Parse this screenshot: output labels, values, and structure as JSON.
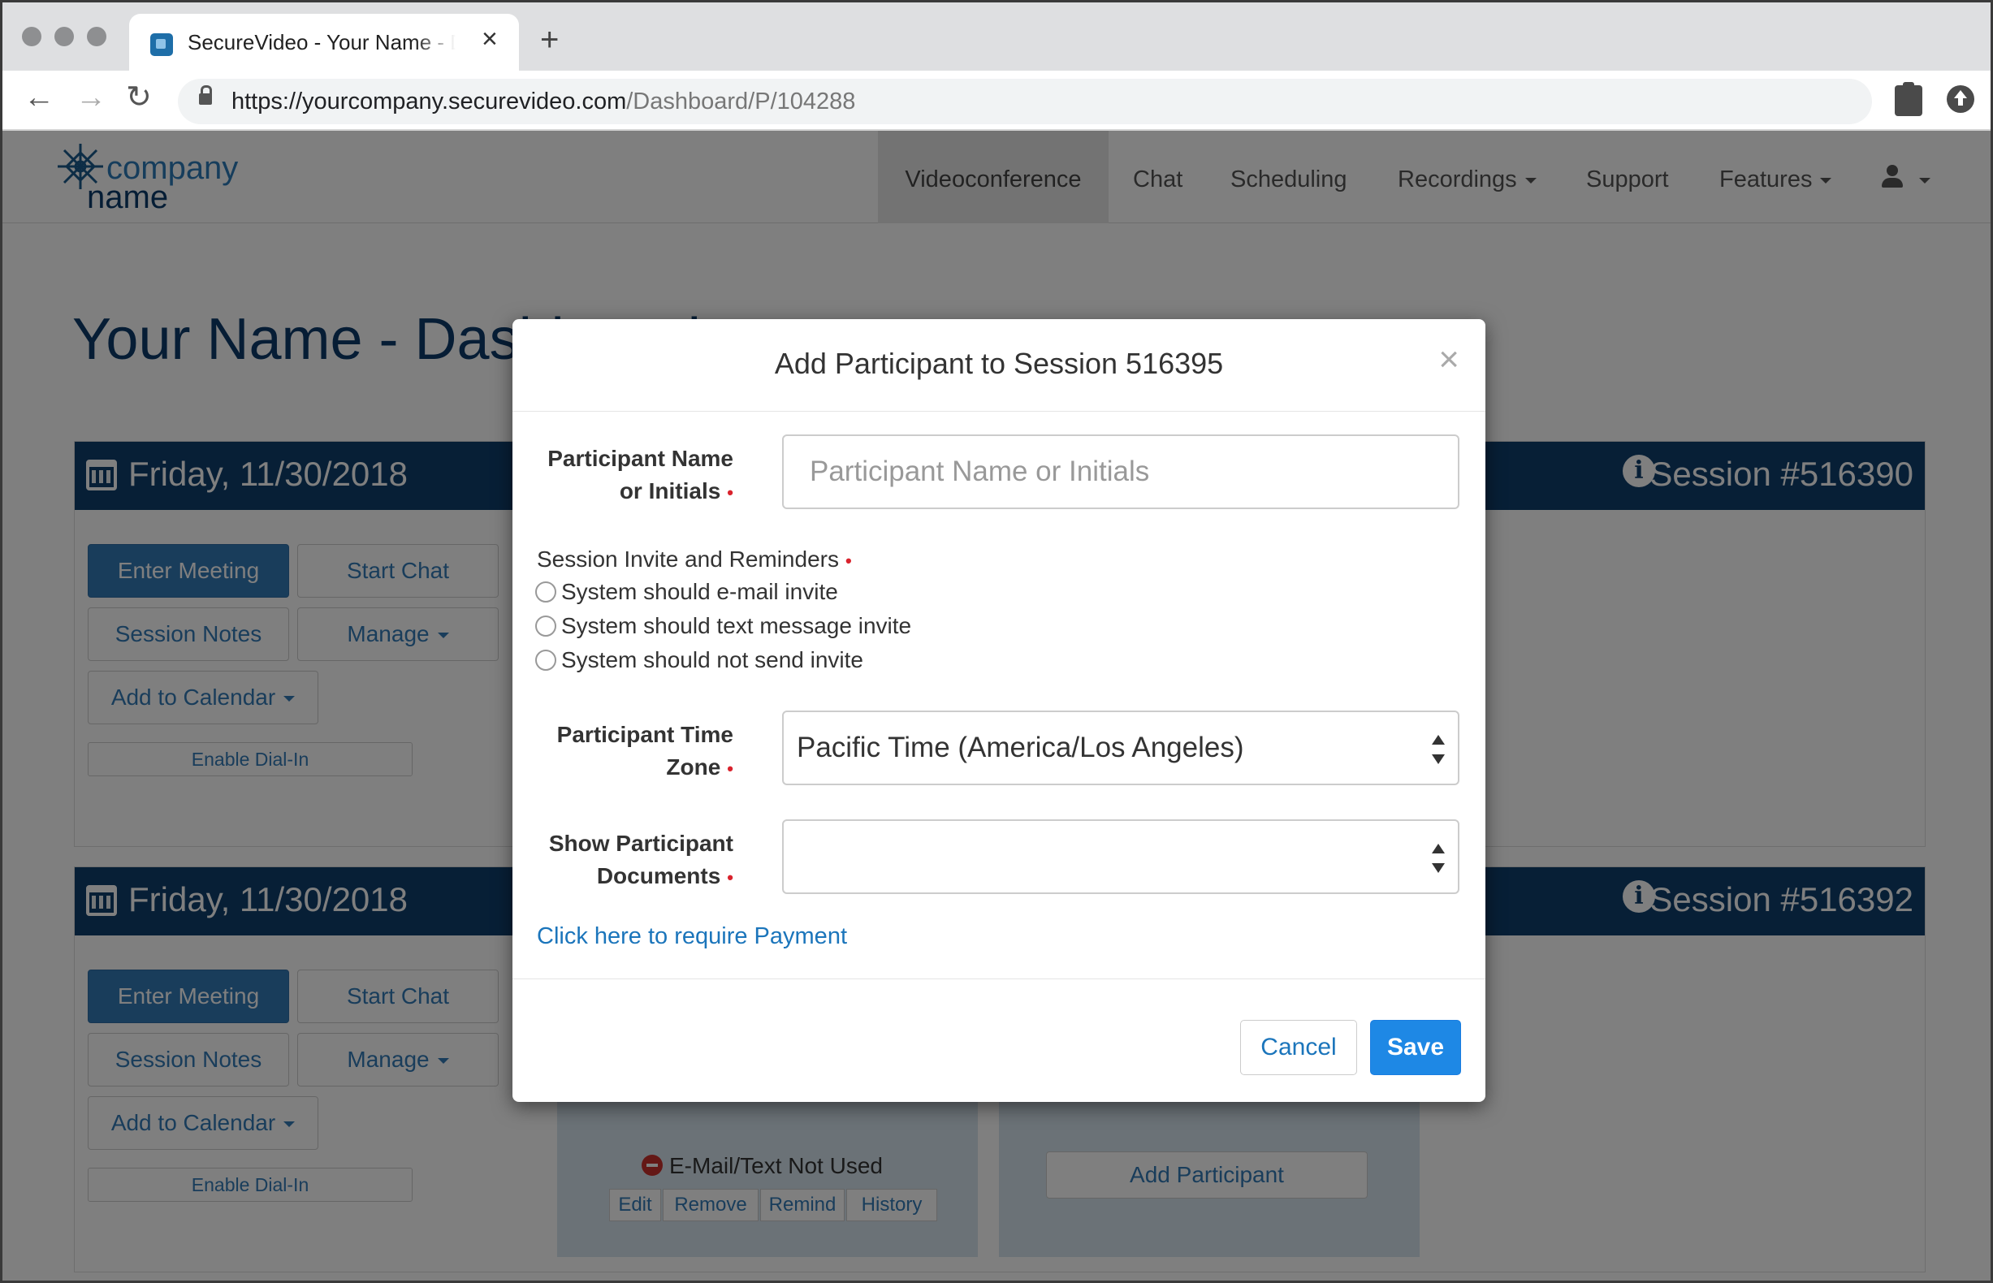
{
  "browser": {
    "tab_title": "SecureVideo - Your Name - Dashboard",
    "url_host": "https://yourcompany.securevideo.com",
    "url_path": "/Dashboard/P/104288"
  },
  "brand": {
    "line1": "company",
    "line2": "name"
  },
  "nav": {
    "items": [
      "Videoconference",
      "Chat",
      "Scheduling",
      "Recordings",
      "Support",
      "Features"
    ]
  },
  "page": {
    "title": "Your Name - Dashboard"
  },
  "sessions": [
    {
      "date": "Friday, 11/30/2018",
      "session": "Session #516390"
    },
    {
      "date": "Friday, 11/30/2018",
      "session": "Session #516392"
    }
  ],
  "card_buttons": {
    "enter_meeting": "Enter Meeting",
    "start_chat": "Start Chat",
    "session_notes": "Session Notes",
    "manage": "Manage",
    "add_to_calendar": "Add to Calendar",
    "enable_dial_in": "Enable Dial-In"
  },
  "participant_panel": {
    "status": "E-Mail/Text Not Used",
    "actions": [
      "Edit",
      "Remove",
      "Remind",
      "History"
    ],
    "add_participant": "Add Participant"
  },
  "modal": {
    "title": "Add Participant to Session 516395",
    "name_label_1": "Participant Name",
    "name_label_2": "or Initials",
    "name_placeholder": "Participant Name or Initials",
    "invite_label": "Session Invite and Reminders",
    "invite_options": [
      "System should e-mail invite",
      "System should text message invite",
      "System should not send invite"
    ],
    "tz_label_1": "Participant Time",
    "tz_label_2": "Zone",
    "tz_value": "Pacific Time (America/Los Angeles)",
    "docs_label_1": "Show Participant",
    "docs_label_2": "Documents",
    "docs_value": "",
    "payment_link": "Click here to require Payment",
    "cancel": "Cancel",
    "save": "Save"
  },
  "colors": {
    "brand_navy": "#0e3e6d",
    "link_blue": "#337ab7",
    "save_blue": "#1e88e5",
    "required_red": "#d9232d"
  }
}
